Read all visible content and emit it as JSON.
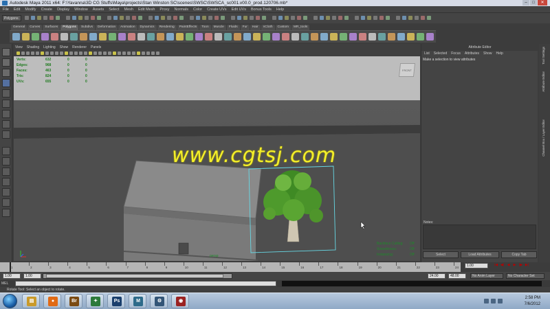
{
  "window": {
    "title": "Autodesk Maya 2011 x64: F:\\Yavanna\\3D CG Stuffs\\Maya\\projects\\Stan Winston SC\\scenes\\SWSC\\SWSCA_sc001.v00.0_prod.120706.mb*",
    "buttons": [
      "–",
      "□",
      "✕"
    ]
  },
  "menubar": [
    "File",
    "Edit",
    "Modify",
    "Create",
    "Display",
    "Window",
    "Assets",
    "Select",
    "Mesh",
    "Edit Mesh",
    "Proxy",
    "Normals",
    "Color",
    "Create UVs",
    "Edit UVs",
    "Bonus Tools",
    "Help"
  ],
  "statusline": {
    "mode": "Polygons"
  },
  "shelf": {
    "tabs": [
      "General",
      "Curves",
      "Surfaces",
      "Polygons",
      "Subdivs",
      "Deformation",
      "Animation",
      "Dynamics",
      "Rendering",
      "PaintEffects",
      "Toon",
      "Muscle",
      "Fluids",
      "Fur",
      "Hair",
      "nCloth",
      "Custom",
      "MR_tools"
    ],
    "active_tab": "Polygons"
  },
  "viewport": {
    "menu": [
      "View",
      "Shading",
      "Lighting",
      "Show",
      "Renderer",
      "Panels"
    ],
    "hud": {
      "rows": [
        {
          "label": "Verts:",
          "v1": "632",
          "v2": "0",
          "v3": "0"
        },
        {
          "label": "Edges:",
          "v1": "968",
          "v2": "0",
          "v3": "0"
        },
        {
          "label": "Faces:",
          "v1": "463",
          "v2": "0",
          "v3": "0"
        },
        {
          "label": "Tris:",
          "v1": "824",
          "v2": "0",
          "v3": "0"
        },
        {
          "label": "UVs:",
          "v1": "655",
          "v2": "0",
          "v3": "0"
        }
      ],
      "view_cube": "FRONT",
      "camera_name": "persp",
      "bottom_right": [
        {
          "label": "Backface Culling:",
          "value": "Off"
        },
        {
          "label": "Smoothness:",
          "value": "Off"
        },
        {
          "label": "Instancing:",
          "value": "Off"
        }
      ],
      "fps": "25"
    },
    "watermark": "www.cgtsj.com"
  },
  "attribute_editor": {
    "title": "Attribute Editor",
    "menu": [
      "List",
      "Selected",
      "Focus",
      "Attributes",
      "Show",
      "Help"
    ],
    "message": "Make a selection to view attributes",
    "notes_label": "Notes:",
    "buttons": [
      "Select",
      "Load Attributes",
      "Copy Tab"
    ],
    "side_tabs": [
      "Channel Box / Layer Editor",
      "Attribute Editor",
      "Tool Settings"
    ]
  },
  "timeslider": {
    "ticks": [
      "1",
      "2",
      "3",
      "4",
      "5",
      "6",
      "7",
      "8",
      "9",
      "10",
      "11",
      "12",
      "13",
      "14",
      "15",
      "16",
      "17",
      "18",
      "19",
      "20",
      "21",
      "22",
      "23",
      "24"
    ],
    "current_frame": "1.00",
    "playback": [
      "|◀",
      "◀|",
      "◀",
      "▶",
      "|▶",
      "▶|"
    ]
  },
  "range": {
    "start": "1.00",
    "inner_start": "1.00",
    "inner_end": "24.00",
    "end": "48.00",
    "anim_layer": "No Anim Layer",
    "char_set": "No Character Set"
  },
  "commandline": {
    "label": "MEL",
    "help": "Rotate Tool: Select an object to rotate."
  },
  "taskbar": {
    "apps": [
      {
        "name": "explorer",
        "glyph": "▤",
        "color": "#c99a2b"
      },
      {
        "name": "firefox",
        "glyph": "●",
        "color": "#e06a15"
      },
      {
        "name": "bridge",
        "glyph": "Br",
        "color": "#7a4a12"
      },
      {
        "name": "3d-app",
        "glyph": "✦",
        "color": "#2b7a3a"
      },
      {
        "name": "photoshop",
        "glyph": "Ps",
        "color": "#1a3f6d"
      },
      {
        "name": "maya",
        "glyph": "M",
        "color": "#2d6b8a"
      },
      {
        "name": "network",
        "glyph": "⚙",
        "color": "#335577"
      },
      {
        "name": "media",
        "glyph": "◉",
        "color": "#9a2222"
      }
    ],
    "clock_time": "2:58 PM",
    "clock_date": "7/6/2012"
  }
}
